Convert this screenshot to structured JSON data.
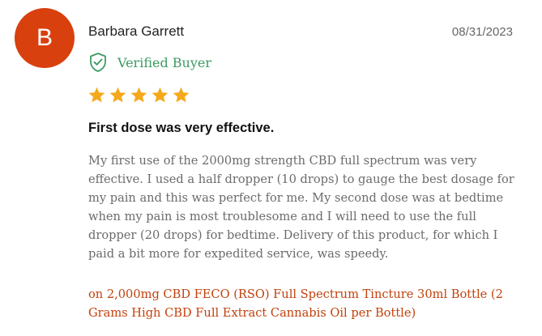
{
  "review": {
    "avatar_initial": "B",
    "reviewer_name": "Barbara Garrett",
    "date": "08/31/2023",
    "verified_label": "Verified Buyer",
    "rating": 5,
    "rating_max": 5,
    "title": "First dose was very effective.",
    "body": "My first use of the 2000mg strength CBD full spectrum was very effective. I used a half dropper (10 drops) to gauge the best dosage for my pain and this was perfect for me. My second dose was at bedtime when my pain is most troublesome and I will need to use the full dropper (20 drops) for bedtime. Delivery of this product, for which I paid a bit more for expedited service, was speedy.",
    "product_link": "on 2,000mg CBD FECO (RSO) Full Spectrum Tincture 30ml Bottle (2 Grams High CBD Full Extract Cannabis Oil per Bottle)"
  },
  "colors": {
    "avatar_bg": "#d8400e",
    "verified": "#3c9a62",
    "star": "#f5a91a",
    "product_link": "#c2410c"
  },
  "icons": {
    "verified": "shield-check-icon",
    "rating": "star-icon"
  }
}
